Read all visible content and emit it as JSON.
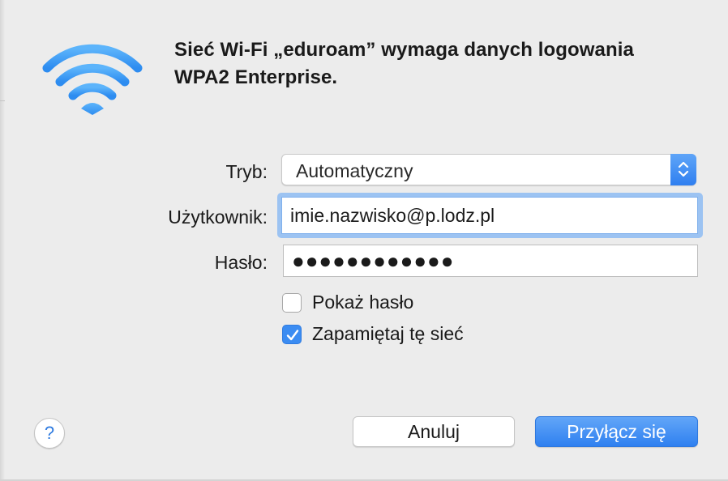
{
  "dialog": {
    "title_line1": "Sieć Wi-Fi „eduroam” wymaga danych logowania",
    "title_line2": "WPA2 Enterprise.",
    "icon": "wifi-icon",
    "accent_color": "#2f80f0"
  },
  "form": {
    "mode_label": "Tryb:",
    "mode_value": "Automatyczny",
    "user_label": "Użytkownik:",
    "user_value": "imie.nazwisko@p.lodz.pl",
    "password_label": "Hasło:",
    "password_masked": "●●●●●●●●●●●●",
    "show_password_label": "Pokaż hasło",
    "show_password_checked": false,
    "remember_label": "Zapamiętaj tę sieć",
    "remember_checked": true
  },
  "buttons": {
    "help": "?",
    "cancel": "Anuluj",
    "connect": "Przyłącz się"
  }
}
